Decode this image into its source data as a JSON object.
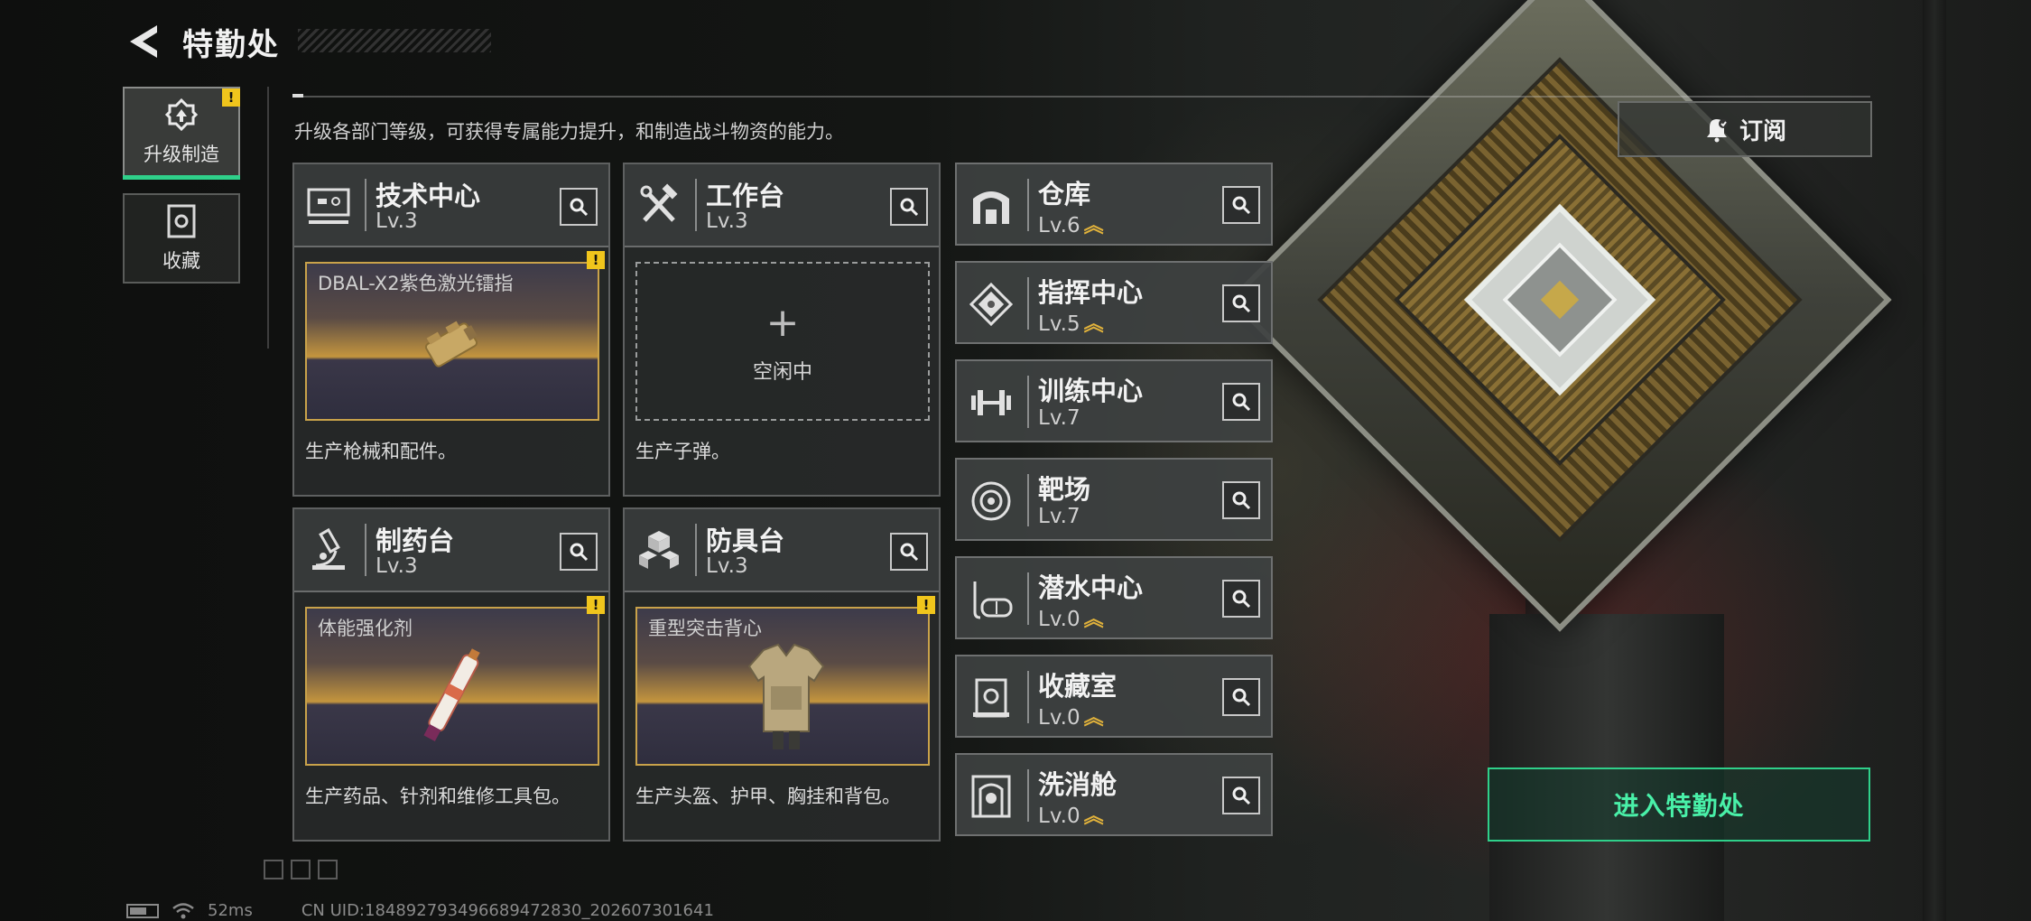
{
  "header": {
    "title": "特勤处",
    "subtitle": "升级各部门等级，可获得专属能力提升，和制造战斗物资的能力。"
  },
  "tabs": [
    {
      "label": "升级制造",
      "active": true,
      "has_alert": true
    },
    {
      "label": "收藏",
      "active": false,
      "has_alert": false
    }
  ],
  "facilities": [
    {
      "name": "技术中心",
      "level": "Lv.3",
      "slot_item": "DBAL-X2紫色激光镭指",
      "slot_alert": true,
      "description": "生产枪械和配件。",
      "icon": "computer-icon"
    },
    {
      "name": "工作台",
      "level": "Lv.3",
      "slot_empty": true,
      "empty_label": "空闲中",
      "description": "生产子弹。",
      "icon": "tools-icon"
    },
    {
      "name": "制药台",
      "level": "Lv.3",
      "slot_item": "体能强化剂",
      "slot_alert": true,
      "description": "生产药品、针剂和维修工具包。",
      "icon": "microscope-icon"
    },
    {
      "name": "防具台",
      "level": "Lv.3",
      "slot_item": "重型突击背心",
      "slot_alert": true,
      "description": "生产头盔、护甲、胸挂和背包。",
      "icon": "armor-blocks-icon"
    }
  ],
  "departments": [
    {
      "name": "仓库",
      "level": "Lv.6",
      "upgradable": true,
      "icon": "warehouse-icon"
    },
    {
      "name": "指挥中心",
      "level": "Lv.5",
      "upgradable": true,
      "icon": "chip-icon"
    },
    {
      "name": "训练中心",
      "level": "Lv.7",
      "upgradable": false,
      "icon": "dumbbell-icon"
    },
    {
      "name": "靶场",
      "level": "Lv.7",
      "upgradable": false,
      "icon": "target-icon"
    },
    {
      "name": "潜水中心",
      "level": "Lv.0",
      "upgradable": true,
      "icon": "diving-mask-icon"
    },
    {
      "name": "收藏室",
      "level": "Lv.0",
      "upgradable": true,
      "icon": "collection-case-icon"
    },
    {
      "name": "洗消舱",
      "level": "Lv.0",
      "upgradable": true,
      "icon": "decon-chamber-icon"
    }
  ],
  "buttons": {
    "subscribe": "订阅",
    "enter": "进入特勤处"
  },
  "status": {
    "ping": "52ms",
    "uid": "CN UID:184892793496689472830_202607301641"
  },
  "colors": {
    "accent_green": "#2fd08a",
    "alert_yellow": "#f0c51c",
    "upgrade_gold": "#e1b23b"
  }
}
